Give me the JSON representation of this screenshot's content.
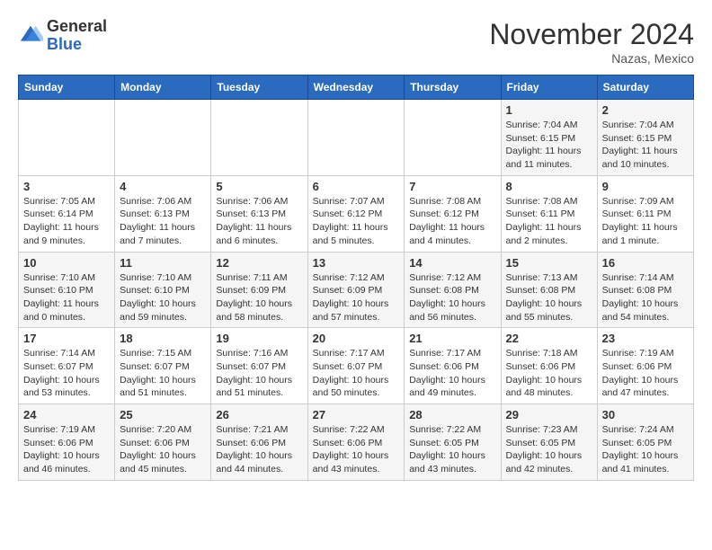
{
  "header": {
    "logo_general": "General",
    "logo_blue": "Blue",
    "month_title": "November 2024",
    "location": "Nazas, Mexico"
  },
  "days_of_week": [
    "Sunday",
    "Monday",
    "Tuesday",
    "Wednesday",
    "Thursday",
    "Friday",
    "Saturday"
  ],
  "weeks": [
    [
      {
        "day": "",
        "info": ""
      },
      {
        "day": "",
        "info": ""
      },
      {
        "day": "",
        "info": ""
      },
      {
        "day": "",
        "info": ""
      },
      {
        "day": "",
        "info": ""
      },
      {
        "day": "1",
        "info": "Sunrise: 7:04 AM\nSunset: 6:15 PM\nDaylight: 11 hours and 11 minutes."
      },
      {
        "day": "2",
        "info": "Sunrise: 7:04 AM\nSunset: 6:15 PM\nDaylight: 11 hours and 10 minutes."
      }
    ],
    [
      {
        "day": "3",
        "info": "Sunrise: 7:05 AM\nSunset: 6:14 PM\nDaylight: 11 hours and 9 minutes."
      },
      {
        "day": "4",
        "info": "Sunrise: 7:06 AM\nSunset: 6:13 PM\nDaylight: 11 hours and 7 minutes."
      },
      {
        "day": "5",
        "info": "Sunrise: 7:06 AM\nSunset: 6:13 PM\nDaylight: 11 hours and 6 minutes."
      },
      {
        "day": "6",
        "info": "Sunrise: 7:07 AM\nSunset: 6:12 PM\nDaylight: 11 hours and 5 minutes."
      },
      {
        "day": "7",
        "info": "Sunrise: 7:08 AM\nSunset: 6:12 PM\nDaylight: 11 hours and 4 minutes."
      },
      {
        "day": "8",
        "info": "Sunrise: 7:08 AM\nSunset: 6:11 PM\nDaylight: 11 hours and 2 minutes."
      },
      {
        "day": "9",
        "info": "Sunrise: 7:09 AM\nSunset: 6:11 PM\nDaylight: 11 hours and 1 minute."
      }
    ],
    [
      {
        "day": "10",
        "info": "Sunrise: 7:10 AM\nSunset: 6:10 PM\nDaylight: 11 hours and 0 minutes."
      },
      {
        "day": "11",
        "info": "Sunrise: 7:10 AM\nSunset: 6:10 PM\nDaylight: 10 hours and 59 minutes."
      },
      {
        "day": "12",
        "info": "Sunrise: 7:11 AM\nSunset: 6:09 PM\nDaylight: 10 hours and 58 minutes."
      },
      {
        "day": "13",
        "info": "Sunrise: 7:12 AM\nSunset: 6:09 PM\nDaylight: 10 hours and 57 minutes."
      },
      {
        "day": "14",
        "info": "Sunrise: 7:12 AM\nSunset: 6:08 PM\nDaylight: 10 hours and 56 minutes."
      },
      {
        "day": "15",
        "info": "Sunrise: 7:13 AM\nSunset: 6:08 PM\nDaylight: 10 hours and 55 minutes."
      },
      {
        "day": "16",
        "info": "Sunrise: 7:14 AM\nSunset: 6:08 PM\nDaylight: 10 hours and 54 minutes."
      }
    ],
    [
      {
        "day": "17",
        "info": "Sunrise: 7:14 AM\nSunset: 6:07 PM\nDaylight: 10 hours and 53 minutes."
      },
      {
        "day": "18",
        "info": "Sunrise: 7:15 AM\nSunset: 6:07 PM\nDaylight: 10 hours and 51 minutes."
      },
      {
        "day": "19",
        "info": "Sunrise: 7:16 AM\nSunset: 6:07 PM\nDaylight: 10 hours and 51 minutes."
      },
      {
        "day": "20",
        "info": "Sunrise: 7:17 AM\nSunset: 6:07 PM\nDaylight: 10 hours and 50 minutes."
      },
      {
        "day": "21",
        "info": "Sunrise: 7:17 AM\nSunset: 6:06 PM\nDaylight: 10 hours and 49 minutes."
      },
      {
        "day": "22",
        "info": "Sunrise: 7:18 AM\nSunset: 6:06 PM\nDaylight: 10 hours and 48 minutes."
      },
      {
        "day": "23",
        "info": "Sunrise: 7:19 AM\nSunset: 6:06 PM\nDaylight: 10 hours and 47 minutes."
      }
    ],
    [
      {
        "day": "24",
        "info": "Sunrise: 7:19 AM\nSunset: 6:06 PM\nDaylight: 10 hours and 46 minutes."
      },
      {
        "day": "25",
        "info": "Sunrise: 7:20 AM\nSunset: 6:06 PM\nDaylight: 10 hours and 45 minutes."
      },
      {
        "day": "26",
        "info": "Sunrise: 7:21 AM\nSunset: 6:06 PM\nDaylight: 10 hours and 44 minutes."
      },
      {
        "day": "27",
        "info": "Sunrise: 7:22 AM\nSunset: 6:06 PM\nDaylight: 10 hours and 43 minutes."
      },
      {
        "day": "28",
        "info": "Sunrise: 7:22 AM\nSunset: 6:05 PM\nDaylight: 10 hours and 43 minutes."
      },
      {
        "day": "29",
        "info": "Sunrise: 7:23 AM\nSunset: 6:05 PM\nDaylight: 10 hours and 42 minutes."
      },
      {
        "day": "30",
        "info": "Sunrise: 7:24 AM\nSunset: 6:05 PM\nDaylight: 10 hours and 41 minutes."
      }
    ]
  ]
}
